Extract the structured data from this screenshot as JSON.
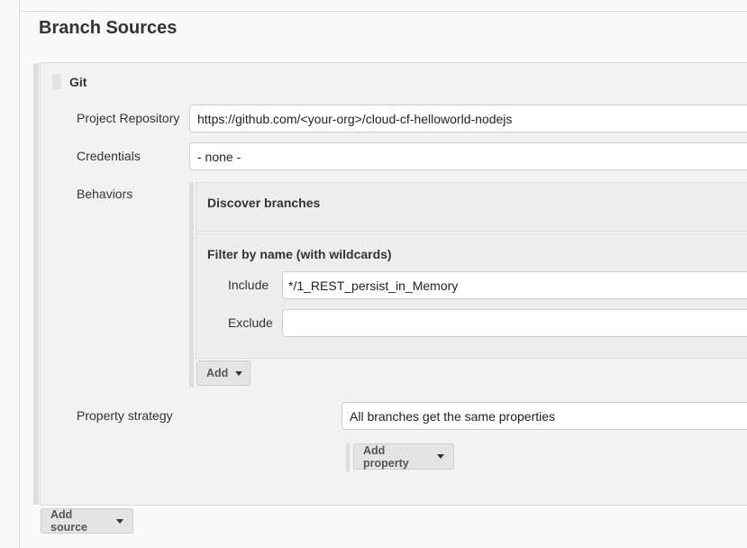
{
  "section_title": "Branch Sources",
  "git": {
    "title": "Git",
    "project_repository_label": "Project Repository",
    "project_repository_value": "https://github.com/<your-org>/cloud-cf-helloworld-nodejs",
    "credentials_label": "Credentials",
    "credentials_value": "- none -",
    "behaviors_label": "Behaviors",
    "behaviors": {
      "discover_title": "Discover branches",
      "filter_title": "Filter by name (with wildcards)",
      "include_label": "Include",
      "include_value": "*/1_REST_persist_in_Memory",
      "exclude_label": "Exclude",
      "exclude_value": "",
      "add_label": "Add"
    },
    "property_strategy_label": "Property strategy",
    "property_strategy_value": "All branches get the same properties",
    "add_property_label": "Add property"
  },
  "add_source_label": "Add source"
}
